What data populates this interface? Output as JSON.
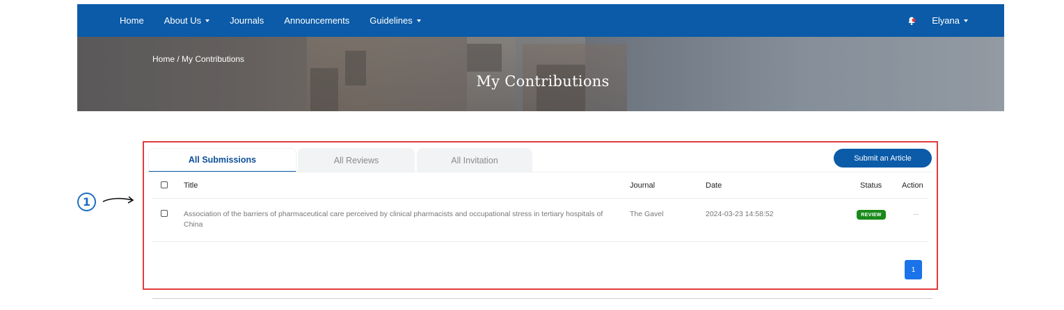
{
  "nav": {
    "items": [
      {
        "label": "Home",
        "dropdown": false
      },
      {
        "label": "About Us",
        "dropdown": true
      },
      {
        "label": "Journals",
        "dropdown": false
      },
      {
        "label": "Announcements",
        "dropdown": false
      },
      {
        "label": "Guidelines",
        "dropdown": true
      }
    ],
    "user": "Elyana"
  },
  "banner": {
    "breadcrumb": "Home / My Contributions",
    "title": "My Contributions"
  },
  "annotation": {
    "number": "1"
  },
  "tabs": [
    {
      "label": "All Submissions",
      "active": true
    },
    {
      "label": "All Reviews",
      "active": false
    },
    {
      "label": "All Invitation",
      "active": false
    }
  ],
  "submit_button": "Submit an Article",
  "table": {
    "headers": {
      "title": "Title",
      "journal": "Journal",
      "date": "Date",
      "status": "Status",
      "action": "Action"
    },
    "rows": [
      {
        "title": "Association of the barriers of pharmaceutical care perceived by clinical pharmacists and occupational stress in tertiary hospitals of China",
        "journal": "The Gavel",
        "date": "2024-03-23 14:58:52",
        "status": "REVIEW",
        "action": "..."
      }
    ]
  },
  "pagination": {
    "current": "1"
  },
  "colors": {
    "navbar": "#0b5ba8",
    "panel_border": "#e23a3a",
    "status_review": "#1a8a1a",
    "page_button": "#1a73e8",
    "annotation": "#1c6fc0"
  }
}
